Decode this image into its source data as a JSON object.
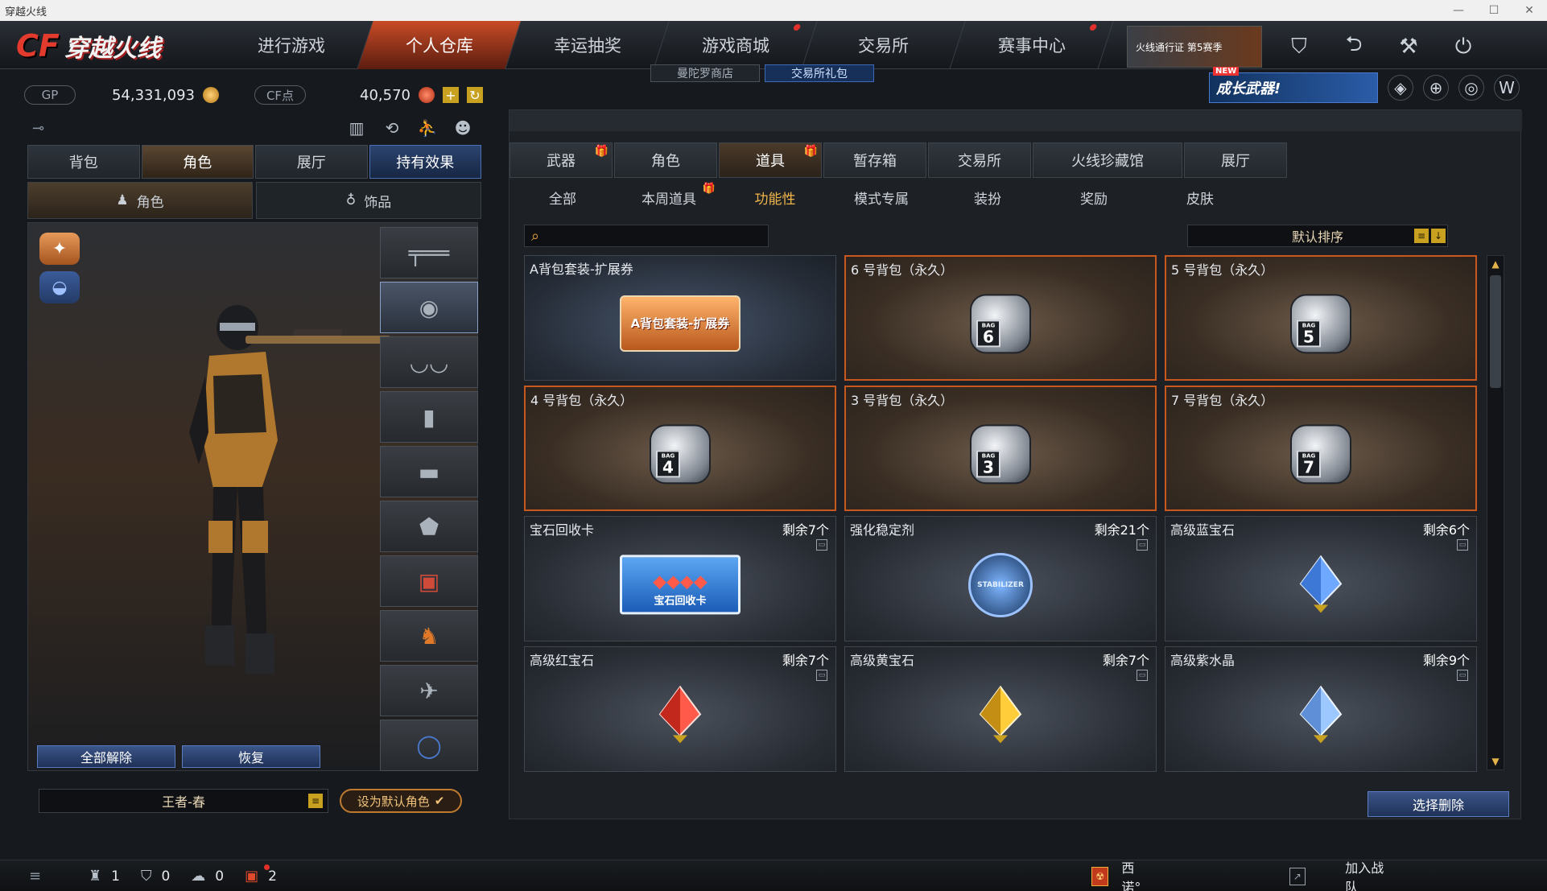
{
  "window": {
    "title": "穿越火线"
  },
  "brand": {
    "logo_cf": "CF",
    "logo_text": "穿越火线"
  },
  "nav": {
    "items": [
      {
        "label": "进行游戏"
      },
      {
        "label": "个人仓库"
      },
      {
        "label": "幸运抽奖"
      },
      {
        "label": "游戏商城"
      },
      {
        "label": "交易所"
      },
      {
        "label": "赛事中心"
      }
    ],
    "sub_items": [
      {
        "label": "曼陀罗商店"
      },
      {
        "label": "交易所礼包"
      }
    ]
  },
  "top_right": {
    "pass_banner": "火线通行证 第5赛季",
    "promo": {
      "badge": "NEW",
      "label": "成长武器!"
    }
  },
  "currency": {
    "gp_label": "GP",
    "gp_value": "54,331,093",
    "cf_label": "CF点",
    "cf_value": "40,570",
    "add_label": "+"
  },
  "left_panel": {
    "key_icon": "⊸",
    "tabs": [
      {
        "label": "背包"
      },
      {
        "label": "角色"
      },
      {
        "label": "展厅"
      },
      {
        "label": "持有效果"
      }
    ],
    "subtabs": [
      {
        "label": "角色"
      },
      {
        "label": "饰品"
      }
    ],
    "buttons": {
      "unequip_all": "全部解除",
      "restore": "恢复"
    },
    "character_name": "王者-春",
    "set_default": "设为默认角色"
  },
  "right_panel": {
    "tabs": [
      {
        "label": "武器",
        "gift": "🎁"
      },
      {
        "label": "角色",
        "gift": ""
      },
      {
        "label": "道具",
        "gift": "🎁"
      },
      {
        "label": "暂存箱",
        "gift": ""
      },
      {
        "label": "交易所",
        "gift": ""
      },
      {
        "label": "火线珍藏馆",
        "gift": ""
      },
      {
        "label": "展厅",
        "gift": ""
      }
    ],
    "subtabs": [
      {
        "label": "全部",
        "gift": ""
      },
      {
        "label": "本周道具",
        "gift": "🎁"
      },
      {
        "label": "功能性",
        "gift": ""
      },
      {
        "label": "模式专属",
        "gift": ""
      },
      {
        "label": "装扮",
        "gift": ""
      },
      {
        "label": "奖励",
        "gift": ""
      },
      {
        "label": "皮肤",
        "gift": ""
      }
    ],
    "search": {
      "placeholder": "",
      "icon": "search-icon"
    },
    "sort_label": "默认排序",
    "items": [
      {
        "name": "A背包套装-扩展券",
        "qty": "",
        "art": "voucher",
        "art_text": "A背包套装-扩展券"
      },
      {
        "name": "6 号背包（永久）",
        "qty": "",
        "art": "bag",
        "bag_no": "6"
      },
      {
        "name": "5 号背包（永久）",
        "qty": "",
        "art": "bag",
        "bag_no": "5"
      },
      {
        "name": "4 号背包（永久）",
        "qty": "",
        "art": "bag",
        "bag_no": "4"
      },
      {
        "name": "3 号背包（永久）",
        "qty": "",
        "art": "bag",
        "bag_no": "3"
      },
      {
        "name": "7 号背包（永久）",
        "qty": "",
        "art": "bag",
        "bag_no": "7"
      },
      {
        "name": "宝石回收卡",
        "qty": "剩余7个",
        "art": "recycle",
        "art_text": "宝石回收卡"
      },
      {
        "name": "强化稳定剂",
        "qty": "剩余21个",
        "art": "stabilizer",
        "art_text": "STABILIZER"
      },
      {
        "name": "高级蓝宝石",
        "qty": "剩余6个",
        "art": "gem",
        "gem_color": "#6fa8ff"
      },
      {
        "name": "高级红宝石",
        "qty": "剩余7个",
        "art": "gem",
        "gem_color": "#ff5a4a"
      },
      {
        "name": "高级黄宝石",
        "qty": "剩余7个",
        "art": "gem",
        "gem_color": "#ffcc3a"
      },
      {
        "name": "高级紫水晶",
        "qty": "剩余9个",
        "art": "gem",
        "gem_color": "#9cc8ff"
      }
    ],
    "delete_button": "选择删除"
  },
  "bottom_bar": {
    "stats": [
      {
        "icon": "team-icon",
        "value": "1"
      },
      {
        "icon": "shield-icon",
        "value": "0"
      },
      {
        "icon": "chat-icon",
        "value": "0"
      },
      {
        "icon": "gift-icon",
        "value": "2"
      }
    ],
    "clan_name": "西诺°",
    "join_team": "加入战队"
  },
  "colors": {
    "accent": "#c9581f",
    "highlight": "#f2b54a",
    "button_blue": "#3b5588"
  }
}
